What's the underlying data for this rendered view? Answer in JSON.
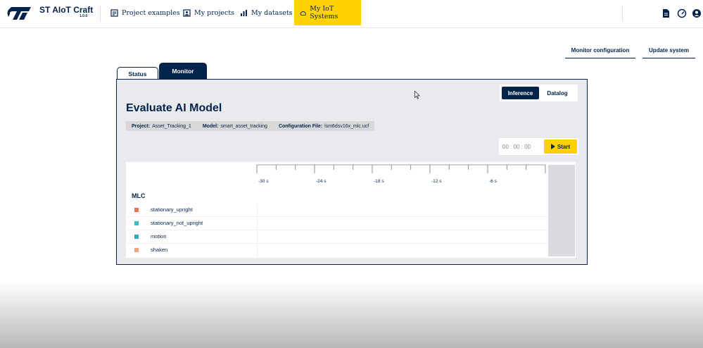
{
  "app": {
    "brand": "ST AIoT Craft",
    "version": "1.0.0"
  },
  "nav": {
    "items": [
      {
        "label": "Project examples",
        "icon": "project-examples-icon"
      },
      {
        "label": "My projects",
        "icon": "my-projects-icon"
      },
      {
        "label": "My datasets",
        "icon": "my-datasets-icon"
      },
      {
        "label": "My IoT Systems",
        "icon": "cloud-icon",
        "active": true
      }
    ],
    "right_icons": [
      "document-icon",
      "dashboard-gauge-icon",
      "user-account-icon"
    ]
  },
  "actions": {
    "monitor_config": "Monitor configuration",
    "update_system": "Update system"
  },
  "tabs": {
    "status": "Status",
    "monitor": "Monitor"
  },
  "mode": {
    "inference": "Inference",
    "datalog": "Datalog",
    "selected": "Inference"
  },
  "main": {
    "title": "Evaluate AI Model",
    "project_label": "Project:",
    "project_value": "Asset_Tracking_1",
    "model_label": "Model:",
    "model_value": "smart_asset_tracking",
    "config_label": "Configuration File:",
    "config_value": "lsm6dsv16x_mlc.ucf"
  },
  "timer": {
    "value": "00 : 00 : 00",
    "start_label": "Start"
  },
  "timeline": {
    "ticks": [
      "-30 s",
      "-24 s",
      "-18 s",
      "-12 s",
      "-6 s"
    ],
    "section_title": "MLC",
    "classes": [
      {
        "label": "stationary_upright",
        "color": "#e8705f"
      },
      {
        "label": "stationary_not_upright",
        "color": "#3bbcc8"
      },
      {
        "label": "motion",
        "color": "#2aa9b8"
      },
      {
        "label": "shaken",
        "color": "#f0a574"
      }
    ]
  },
  "colors": {
    "primary": "#03234b",
    "accent": "#ffd200",
    "panel_bg": "#e8eaed"
  }
}
